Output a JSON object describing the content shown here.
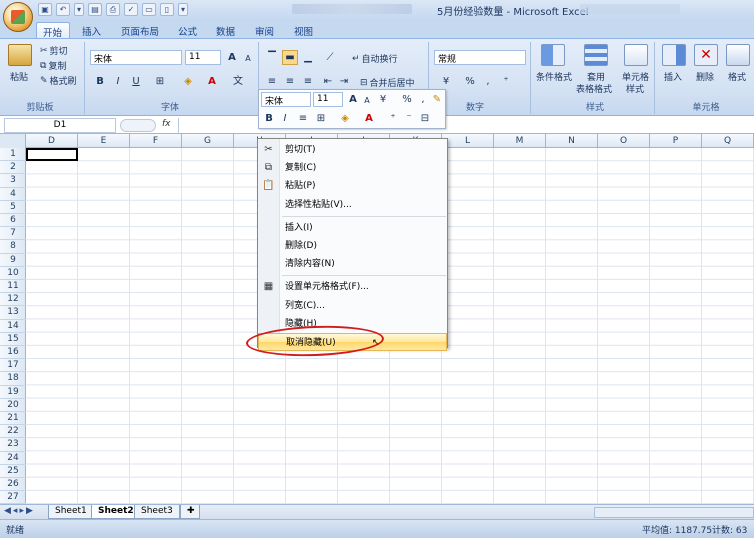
{
  "window": {
    "title": "5月份经验数量 - Microsoft Excel"
  },
  "tabs": [
    {
      "label": "开始",
      "active": true
    },
    {
      "label": "插入"
    },
    {
      "label": "页面布局"
    },
    {
      "label": "公式"
    },
    {
      "label": "数据"
    },
    {
      "label": "审阅"
    },
    {
      "label": "视图"
    }
  ],
  "ribbon": {
    "clipboard": {
      "label": "剪贴板",
      "paste": "粘贴",
      "cut": "剪切",
      "copy": "复制",
      "format_painter": "格式刷"
    },
    "font": {
      "label": "字体",
      "name": "宋体",
      "size": "11",
      "bold": "B",
      "italic": "I",
      "underline": "U",
      "grow": "A",
      "shrink": "A",
      "font_color_letter": "A"
    },
    "alignment": {
      "wrap_text": "自动换行",
      "merge_center": "合并后居中"
    },
    "number": {
      "label": "数字",
      "format": "常规",
      "percent": "%",
      "comma": ","
    },
    "styles": {
      "label": "样式",
      "conditional": "条件格式",
      "table_format_line1": "套用",
      "table_format_line2": "表格格式",
      "cell_styles_line1": "单元格",
      "cell_styles_line2": "样式"
    },
    "cells": {
      "label": "单元格",
      "insert": "插入",
      "delete": "删除",
      "format": "格式"
    }
  },
  "formula_bar": {
    "name_box": "D1",
    "fx": "fx",
    "value": ""
  },
  "columns": [
    "D",
    "E",
    "F",
    "G",
    "H",
    "I",
    "J",
    "K",
    "L",
    "M",
    "N",
    "O",
    "P",
    "Q"
  ],
  "rows": [
    "1",
    "2",
    "3",
    "4",
    "5",
    "6",
    "7",
    "8",
    "9",
    "10",
    "11",
    "12",
    "13",
    "14",
    "15",
    "16",
    "17",
    "18",
    "19",
    "20",
    "21",
    "22",
    "23",
    "24",
    "25",
    "26",
    "27"
  ],
  "mini_toolbar": {
    "font": "宋体",
    "size": "11",
    "grow": "A",
    "shrink": "A",
    "percent": "%",
    "comma": ",",
    "bold": "B",
    "italic": "I",
    "font_color_letter": "A"
  },
  "context_menu": [
    {
      "label": "剪切(T)",
      "icon": "scissors-icon"
    },
    {
      "label": "复制(C)",
      "icon": "copy-icon"
    },
    {
      "label": "粘贴(P)",
      "icon": "paste-icon"
    },
    {
      "label": "选择性粘贴(V)...",
      "icon": ""
    },
    {
      "sep": true
    },
    {
      "label": "插入(I)",
      "icon": ""
    },
    {
      "label": "删除(D)",
      "icon": ""
    },
    {
      "label": "清除内容(N)",
      "icon": ""
    },
    {
      "sep": true
    },
    {
      "label": "设置单元格格式(F)...",
      "icon": "format-cells-icon"
    },
    {
      "label": "列宽(C)...",
      "icon": ""
    },
    {
      "label": "隐藏(H)",
      "icon": ""
    },
    {
      "label": "取消隐藏(U)",
      "icon": "",
      "highlighted": true
    }
  ],
  "sheets": [
    {
      "label": "Sheet1"
    },
    {
      "label": "Sheet2",
      "active": true
    },
    {
      "label": "Sheet3"
    }
  ],
  "status": {
    "mode": "就绪",
    "average": "平均值: 1187.75",
    "count": "计数: 63"
  },
  "colors": {
    "accent": "#15428b",
    "annotation": "#d21c1c",
    "highlight": "#ffd76a"
  }
}
